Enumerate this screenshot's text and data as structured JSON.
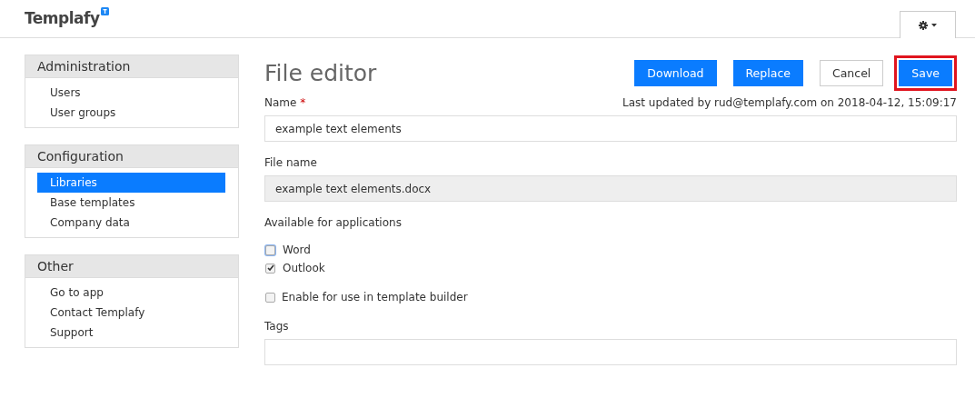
{
  "header": {
    "logo": "Templafy"
  },
  "sidebar": [
    {
      "title": "Administration",
      "items": [
        {
          "label": "Users",
          "selected": false
        },
        {
          "label": "User groups",
          "selected": false
        }
      ]
    },
    {
      "title": "Configuration",
      "items": [
        {
          "label": "Libraries",
          "selected": true
        },
        {
          "label": "Base templates",
          "selected": false
        },
        {
          "label": "Company data",
          "selected": false
        }
      ]
    },
    {
      "title": "Other",
      "items": [
        {
          "label": "Go to app",
          "selected": false
        },
        {
          "label": "Contact Templafy",
          "selected": false
        },
        {
          "label": "Support",
          "selected": false
        }
      ]
    }
  ],
  "page": {
    "title": "File editor",
    "buttons": [
      {
        "label": "Download",
        "kind": "primary",
        "highlighted": false
      },
      {
        "label": "Replace",
        "kind": "primary",
        "highlighted": false
      },
      {
        "label": "Cancel",
        "kind": "default",
        "highlighted": false
      },
      {
        "label": "Save",
        "kind": "primary",
        "highlighted": true
      }
    ],
    "name_label": "Name",
    "required_mark": "*",
    "last_updated": "Last updated by rud@templafy.com on 2018-04-12, 15:09:17",
    "name_value": "example text elements",
    "file_name_label": "File name",
    "file_name_value": "example text elements.docx",
    "file_name_disabled": true,
    "applications_label": "Available for applications",
    "applications": [
      {
        "label": "Word",
        "checked": false,
        "focused": true
      },
      {
        "label": "Outlook",
        "checked": true,
        "focused": false
      }
    ],
    "template_builder": {
      "label": "Enable for use in template builder",
      "checked": false
    },
    "tags_label": "Tags"
  }
}
